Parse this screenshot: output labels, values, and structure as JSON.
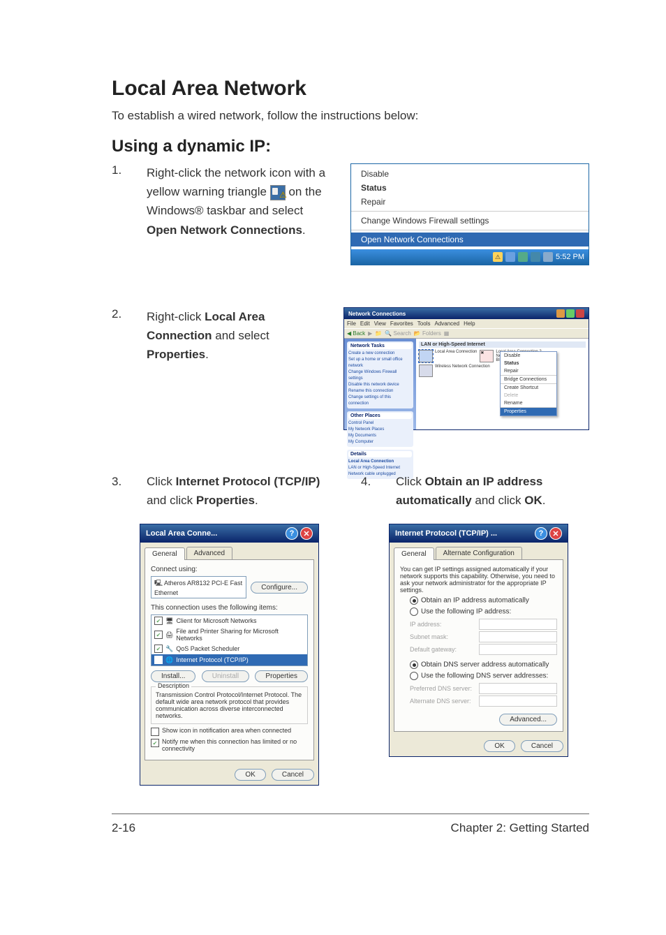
{
  "h1": "Local Area Network",
  "intro": "To establish a wired network, follow the instructions below:",
  "h2": "Using a dynamic IP:",
  "step1": {
    "num": "1.",
    "parts": {
      "a": "Right-click the network icon with a yellow warning triangle",
      "b": "on the Windows® taskbar and select",
      "open_nc": "Open Network Connections",
      "dot": "."
    }
  },
  "step2": {
    "num": "2.",
    "parts": {
      "a": "Right-click",
      "lac": "Local Area Connection",
      "b": "and select",
      "props": "Properties",
      "dot": "."
    }
  },
  "step3": {
    "num": "3.",
    "parts": {
      "a": "Click",
      "ip": "Internet Protocol (TCP/IP)",
      "b": "and click",
      "props": "Properties",
      "dot": "."
    }
  },
  "step4": {
    "num": "4.",
    "parts": {
      "a": "Click",
      "obt": "Obtain an IP address automatically",
      "b": "and click",
      "ok": "OK",
      "dot": "."
    }
  },
  "scr1": {
    "disable": "Disable",
    "status": "Status",
    "repair": "Repair",
    "fw": "Change Windows Firewall settings",
    "open": "Open Network Connections",
    "clock": "5:52 PM"
  },
  "scr2": {
    "title": "Network Connections",
    "menubar": [
      "File",
      "Edit",
      "View",
      "Favorites",
      "Tools",
      "Advanced",
      "Help"
    ],
    "toolbar": {
      "back": "Back",
      "search": "Search",
      "folders": "Folders"
    },
    "sidebar": {
      "panel1_head": "Network Tasks",
      "panel1_links": [
        "Create a new connection",
        "Set up a home or small office network",
        "Change Windows Firewall settings",
        "Disable this network device",
        "Rename this connection",
        "Change settings of this connection"
      ],
      "panel2_head": "Other Places",
      "panel2_links": [
        "Control Panel",
        "My Network Places",
        "My Documents",
        "My Computer"
      ],
      "panel3_head": "Details",
      "panel3_links": [
        "Local Area Connection",
        "LAN or High-Speed Internet",
        "Network cable unplugged"
      ]
    },
    "main_header": "LAN or High-Speed Internet",
    "conns": {
      "a": "Local Area Connection",
      "b": "Wireless Network Connection",
      "c": "Local Area Connection 2",
      "c2": "Network cable unplugged, fire...",
      "c3": "Bluetooth LAN Access Server..."
    },
    "ctx": {
      "disable": "Disable",
      "status": "Status",
      "repair": "Repair",
      "bridge": "Bridge Connections",
      "shortcut": "Create Shortcut",
      "delete": "Delete",
      "rename": "Rename",
      "props": "Properties"
    }
  },
  "scr3": {
    "title": "Local Area Conne...",
    "tab_general": "General",
    "tab_adv": "Advanced",
    "connect_using": "Connect using:",
    "nic": "Atheros AR8132 PCI-E Fast Ethernet",
    "configure": "Configure...",
    "uses": "This connection uses the following items:",
    "items": [
      "Client for Microsoft Networks",
      "File and Printer Sharing for Microsoft Networks",
      "QoS Packet Scheduler",
      "Internet Protocol (TCP/IP)"
    ],
    "install": "Install...",
    "uninstall": "Uninstall",
    "properties": "Properties",
    "desc_head": "Description",
    "desc": "Transmission Control Protocol/Internet Protocol. The default wide area network protocol that provides communication across diverse interconnected networks.",
    "show_icon": "Show icon in notification area when connected",
    "notify": "Notify me when this connection has limited or no connectivity",
    "ok": "OK",
    "cancel": "Cancel"
  },
  "scr4": {
    "title": "Internet Protocol (TCP/IP) ...",
    "tab_general": "General",
    "tab_alt": "Alternate Configuration",
    "blurb": "You can get IP settings assigned automatically if your network supports this capability. Otherwise, you need to ask your network administrator for the appropriate IP settings.",
    "r_obtain": "Obtain an IP address automatically",
    "r_use": "Use the following IP address:",
    "ip": "IP address:",
    "subnet": "Subnet mask:",
    "gateway": "Default gateway:",
    "r_obtain_dns": "Obtain DNS server address automatically",
    "r_use_dns": "Use the following DNS server addresses:",
    "pref_dns": "Preferred DNS server:",
    "alt_dns": "Alternate DNS server:",
    "advanced": "Advanced...",
    "ok": "OK",
    "cancel": "Cancel"
  },
  "footer": {
    "left": "2-16",
    "right": "Chapter 2: Getting Started"
  }
}
